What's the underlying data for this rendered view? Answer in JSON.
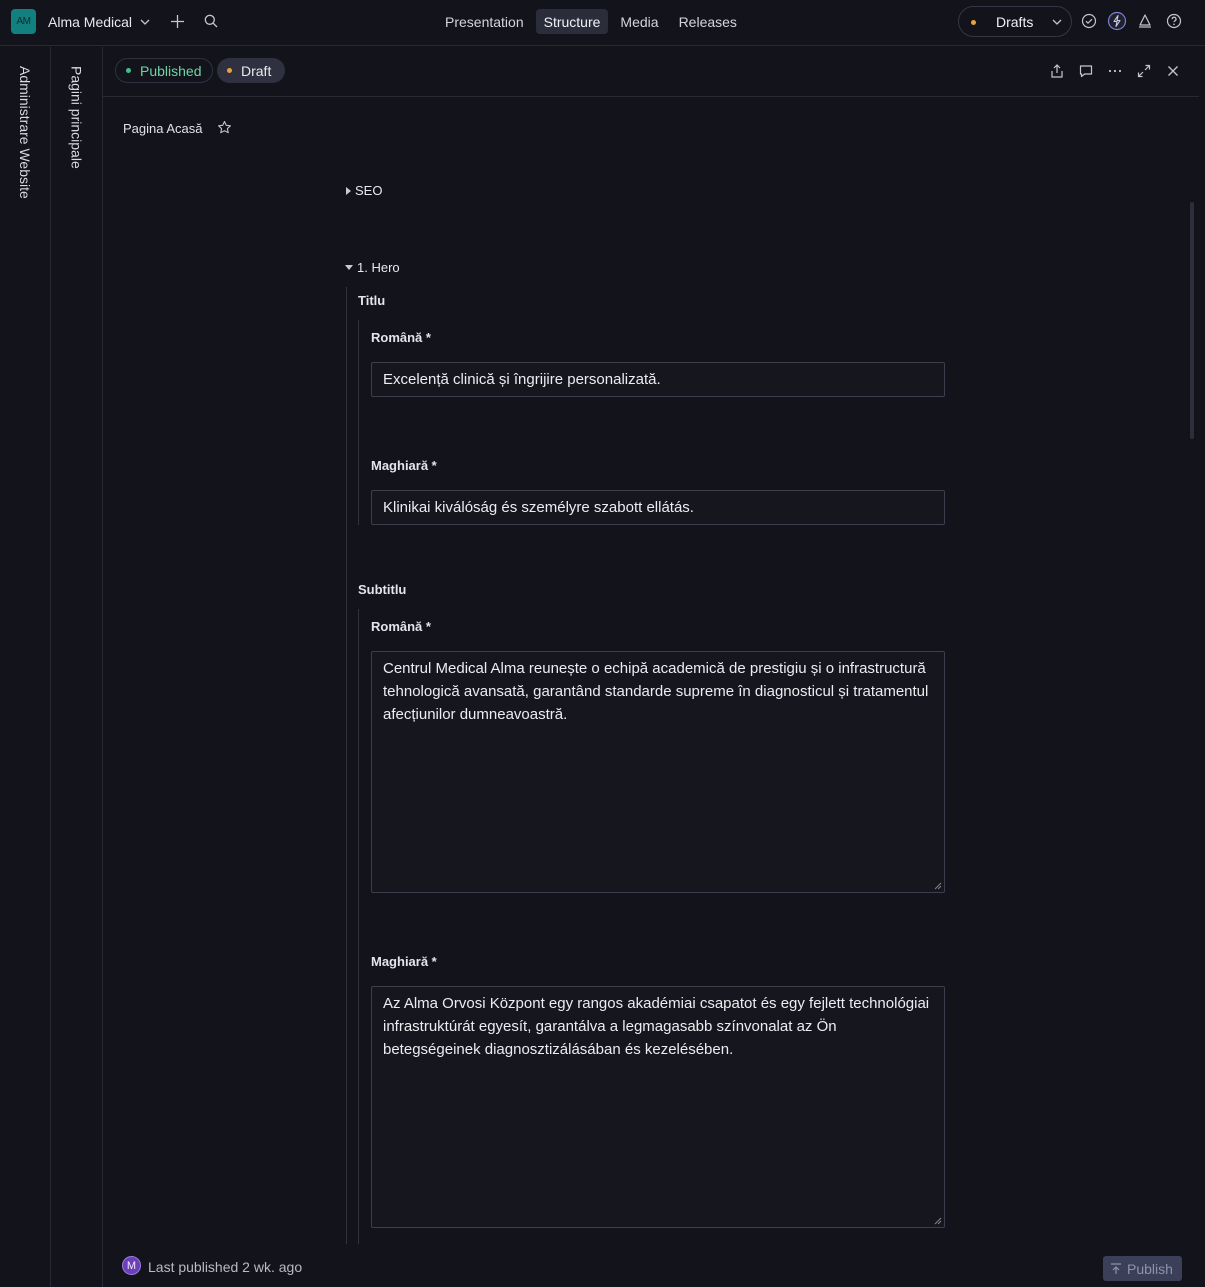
{
  "workspace": {
    "initials": "AM",
    "name": "Alma Medical"
  },
  "nav": {
    "items": [
      "Presentation",
      "Structure",
      "Media",
      "Releases"
    ],
    "active": "Structure"
  },
  "drafts": {
    "label": "Drafts"
  },
  "rails": {
    "admin": "Administrare Website",
    "pages": "Pagini principale"
  },
  "document": {
    "chips": {
      "published": "Published",
      "draft": "Draft"
    },
    "title": "Pagina Acasă",
    "sections": {
      "seo": "SEO",
      "hero": "1. Hero"
    },
    "titlu": {
      "label": "Titlu",
      "ro_label": "Română *",
      "ro_value": "Excelență clinică și îngrijire personalizată.",
      "hu_label": "Maghiară *",
      "hu_value": "Klinikai kiválóság és személyre szabott ellátás."
    },
    "subtitlu": {
      "label": "Subtitlu",
      "ro_label": "Română *",
      "ro_value": "Centrul Medical Alma reunește o echipă academică de prestigiu și o infrastructură tehnologică avansată, garantând standarde supreme în diagnosticul și tratamentul afecțiunilor dumneavoastră.",
      "hu_label": "Maghiară *",
      "hu_value": "Az Alma Orvosi Központ egy rangos akadémiai csapatot és egy fejlett technológiai infrastruktúrát egyesít, garantálva a legmagasabb színvonalat az Ön betegségeinek diagnosztizálásában és kezelésében."
    }
  },
  "footer": {
    "avatar_initial": "M",
    "status": "Last published 2 wk. ago",
    "publish": "Publish"
  },
  "colors": {
    "background": "#13141b",
    "published": "#6fd3a5",
    "draft_dot": "#e5a33d",
    "accent_avatar": "#12807f"
  }
}
